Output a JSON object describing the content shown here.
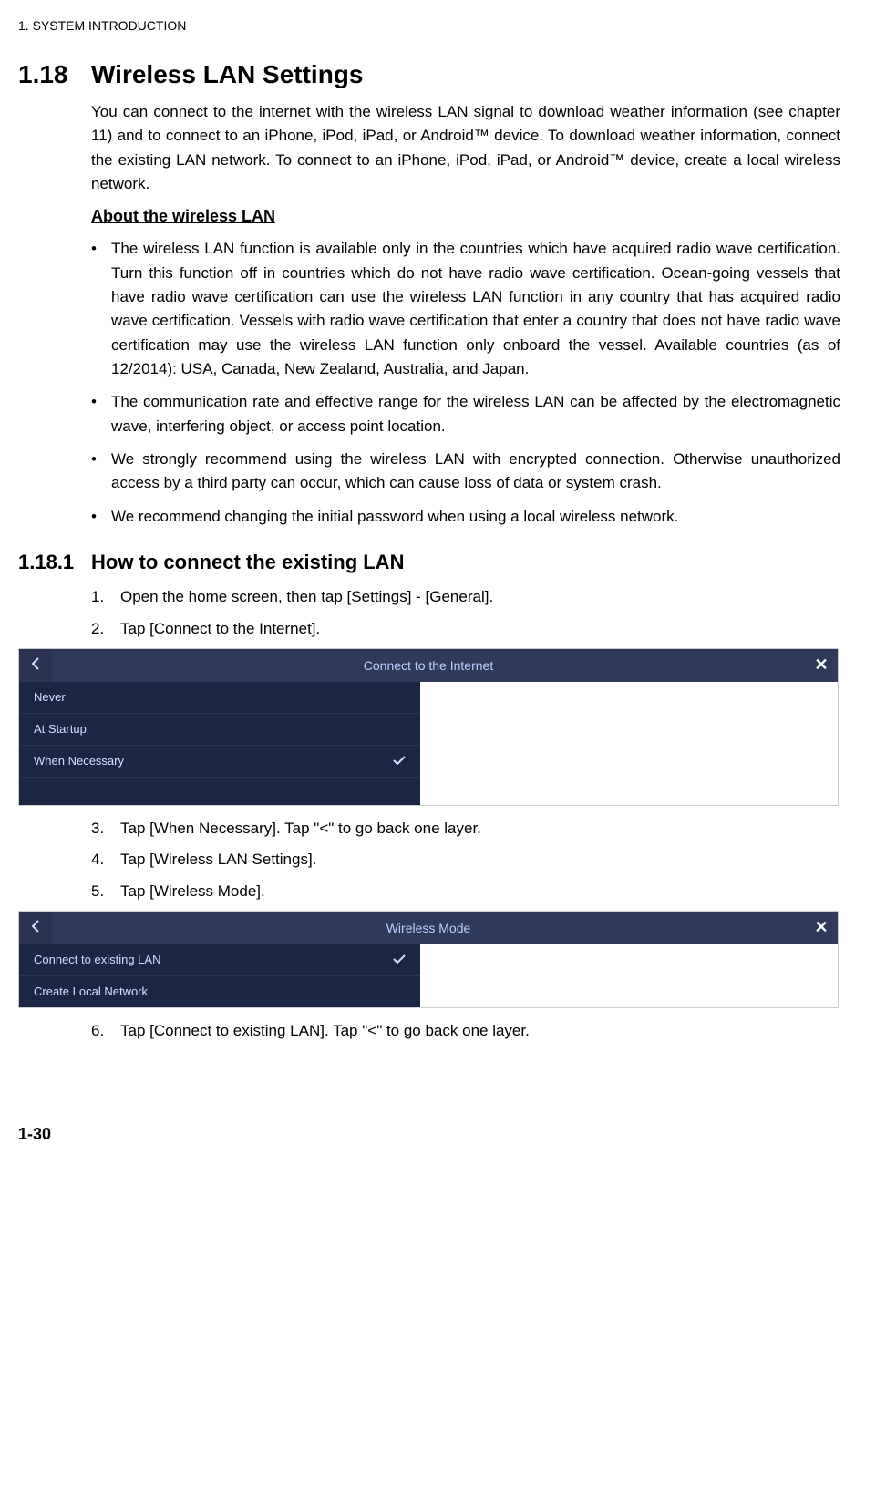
{
  "runningHeader": "1.  SYSTEM INTRODUCTION",
  "section": {
    "number": "1.18",
    "title": "Wireless LAN Settings",
    "intro": "You can connect to the internet with the wireless LAN signal to download weather information (see chapter 11) and to connect to an iPhone, iPod, iPad, or Android™ device. To download weather information, connect the existing LAN network. To connect to an iPhone, iPod, iPad, or Android™ device, create a local wireless network."
  },
  "aboutHeading": "About the wireless LAN",
  "bullets": [
    "The wireless LAN function is available only in the countries which have acquired radio wave certification. Turn this function off in countries which do not have radio wave certification. Ocean-going vessels that have radio wave certification can use the wireless LAN function in any country that has acquired radio wave certification. Vessels with radio wave certification that enter a country that does not have radio wave certification may use the wireless LAN function only onboard the vessel. Available countries (as of 12/2014): USA, Canada, New Zealand, Australia, and Japan.",
    "The communication rate and effective range for the wireless LAN can be affected by the electromagnetic wave, interfering object, or access point location.",
    "We strongly recommend using the wireless LAN with encrypted connection. Otherwise unauthorized access by a third party can occur, which can cause loss of data or system crash.",
    "We recommend changing the initial password when using a local wireless network."
  ],
  "subsection": {
    "number": "1.18.1",
    "title": "How to connect the existing LAN"
  },
  "stepsA": [
    "Open the home screen, then tap [Settings] - [General].",
    "Tap [Connect to the Internet]."
  ],
  "panel1": {
    "title": "Connect to the Internet",
    "options": [
      "Never",
      "At Startup",
      "When Necessary"
    ],
    "selectedIndex": 2
  },
  "stepsB": [
    "Tap [When Necessary]. Tap \"<\" to go back one layer.",
    "Tap [Wireless LAN Settings].",
    "Tap [Wireless Mode]."
  ],
  "panel2": {
    "title": "Wireless Mode",
    "options": [
      "Connect to existing LAN",
      "Create Local Network"
    ],
    "selectedIndex": 0
  },
  "stepsC": [
    "Tap [Connect to existing LAN]. Tap \"<\" to go back one layer."
  ],
  "pageNumber": "1-30"
}
